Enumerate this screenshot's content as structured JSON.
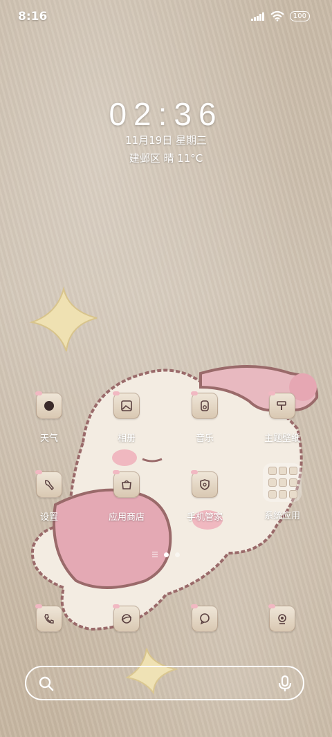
{
  "status_bar": {
    "time": "8:16",
    "battery": "100",
    "icons": [
      "signal-icon",
      "wifi-icon",
      "battery-icon"
    ]
  },
  "lockclock": {
    "time": "02:36",
    "date": "11月19日 星期三",
    "weather": "建邺区 晴 11°C"
  },
  "apps_row1": [
    {
      "label": "天气",
      "icon": "weather-icon"
    },
    {
      "label": "相册",
      "icon": "gallery-icon"
    },
    {
      "label": "音乐",
      "icon": "music-icon"
    },
    {
      "label": "主题壁纸",
      "icon": "theme-icon"
    }
  ],
  "apps_row2": [
    {
      "label": "设置",
      "icon": "settings-icon"
    },
    {
      "label": "应用商店",
      "icon": "app-store-icon"
    },
    {
      "label": "手机管家",
      "icon": "security-icon"
    },
    {
      "label": "系统应用",
      "icon": "folder-icon"
    }
  ],
  "dock": [
    {
      "icon": "phone-icon"
    },
    {
      "icon": "browser-icon"
    },
    {
      "icon": "messages-icon"
    },
    {
      "icon": "camera-icon"
    }
  ],
  "pager": {
    "pages": 2,
    "current": 1
  },
  "search": {
    "placeholder": ""
  },
  "colors": {
    "accent": "#ffffff",
    "tile": "#e6d9c7",
    "tile_border": "#8a6a58",
    "bow": "#f1b8c2"
  }
}
